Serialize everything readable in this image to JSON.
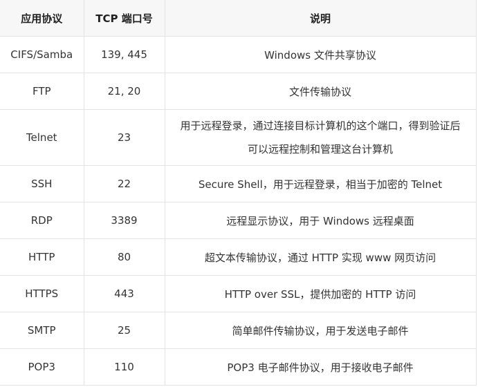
{
  "table": {
    "headers": [
      "应用协议",
      "TCP 端口号",
      "说明"
    ],
    "rows": [
      {
        "protocol": "CIFS/Samba",
        "port": "139, 445",
        "description": "Windows 文件共享协议"
      },
      {
        "protocol": "FTP",
        "port": "21, 20",
        "description": "文件传输协议"
      },
      {
        "protocol": "Telnet",
        "port": "23",
        "description": "用于远程登录，通过连接目标计算机的这个端口，得到验证后可以远程控制和管理这台计算机"
      },
      {
        "protocol": "SSH",
        "port": "22",
        "description": "Secure Shell，用于远程登录，相当于加密的 Telnet"
      },
      {
        "protocol": "RDP",
        "port": "3389",
        "description": "远程显示协议，用于 Windows 远程桌面"
      },
      {
        "protocol": "HTTP",
        "port": "80",
        "description": "超文本传输协议，通过 HTTP 实现 www 网页访问"
      },
      {
        "protocol": "HTTPS",
        "port": "443",
        "description": "HTTP over SSL，提供加密的 HTTP 访问"
      },
      {
        "protocol": "SMTP",
        "port": "25",
        "description": "简单邮件传输协议，用于发送电子邮件"
      },
      {
        "protocol": "POP3",
        "port": "110",
        "description": "POP3 电子邮件协议，用于接收电子邮件"
      }
    ]
  }
}
